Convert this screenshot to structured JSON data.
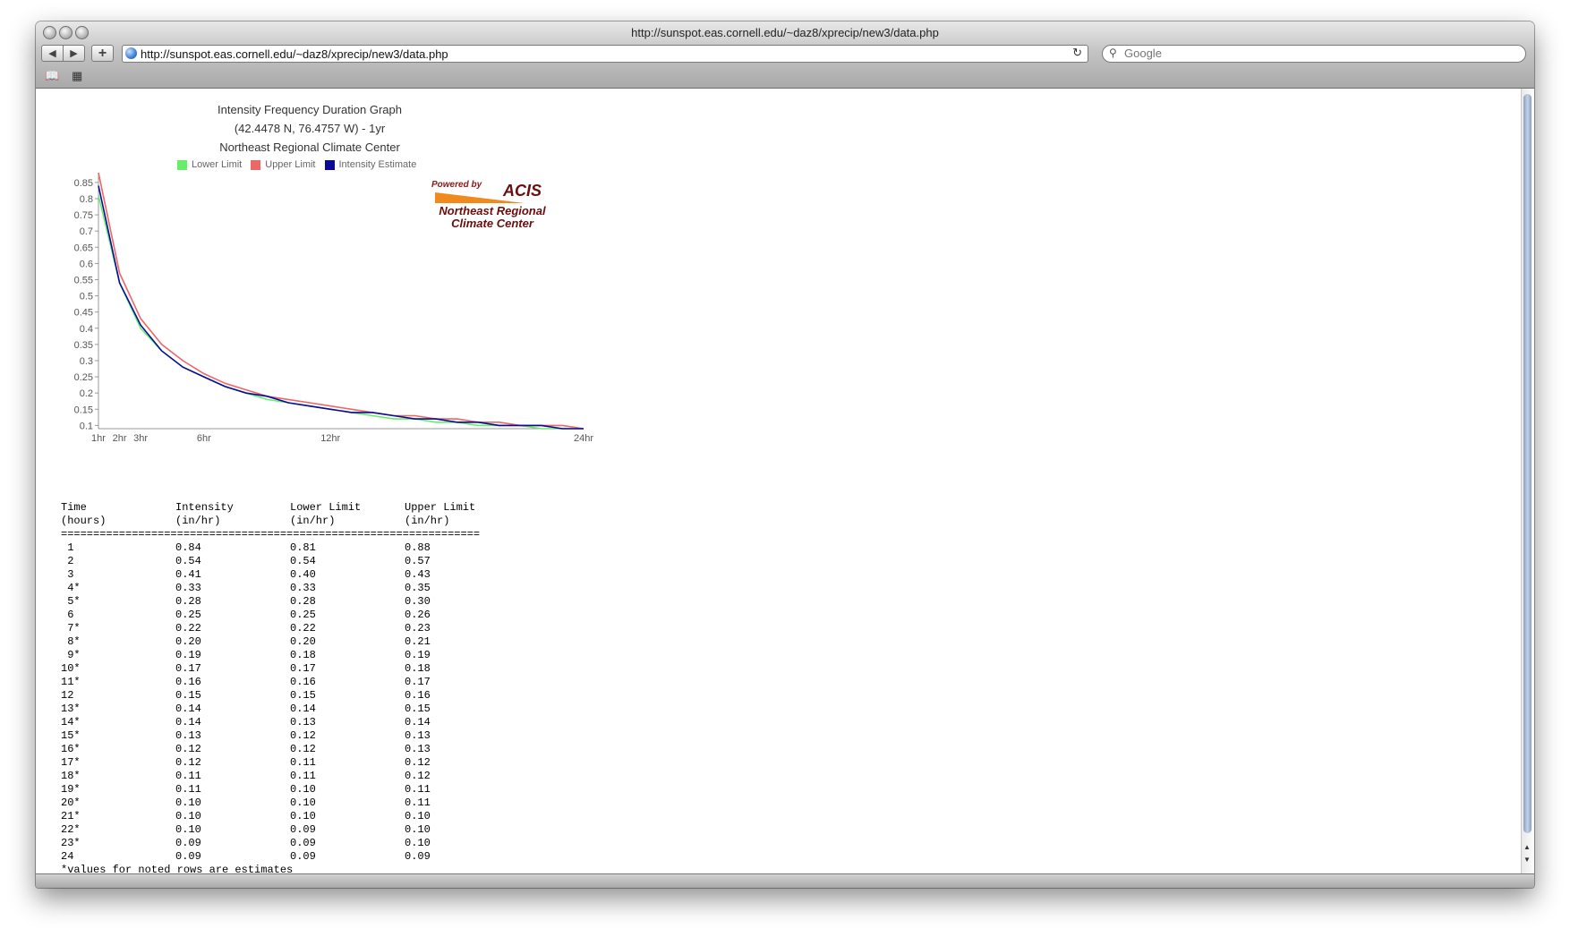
{
  "window": {
    "title": "http://sunspot.eas.cornell.edu/~daz8/xprecip/new3/data.php"
  },
  "toolbar": {
    "back_label": "◀",
    "forward_label": "▶",
    "add_label": "+",
    "url": "http://sunspot.eas.cornell.edu/~daz8/xprecip/new3/data.php",
    "reload_label": "↻",
    "search_placeholder": "Google"
  },
  "chart": {
    "title_lines": [
      "Intensity Frequency Duration Graph",
      "(42.4478 N, 76.4757 W) - 1yr",
      "Northeast Regional Climate Center"
    ],
    "logo": {
      "powered_by": "Powered by",
      "brand": "ACIS",
      "line1": "Northeast Regional",
      "line2": "Climate Center"
    }
  },
  "chart_data": {
    "type": "line",
    "x": [
      1,
      2,
      3,
      4,
      5,
      6,
      7,
      8,
      9,
      10,
      11,
      12,
      13,
      14,
      15,
      16,
      17,
      18,
      19,
      20,
      21,
      22,
      23,
      24
    ],
    "x_tick_labels": [
      {
        "x": 1,
        "label": "1hr"
      },
      {
        "x": 2,
        "label": "2hr"
      },
      {
        "x": 3,
        "label": "3hr"
      },
      {
        "x": 6,
        "label": "6hr"
      },
      {
        "x": 12,
        "label": "12hr"
      },
      {
        "x": 24,
        "label": "24hr"
      }
    ],
    "y_ticks": [
      0.1,
      0.15,
      0.2,
      0.25,
      0.3,
      0.35,
      0.4,
      0.45,
      0.5,
      0.55,
      0.6,
      0.65,
      0.7,
      0.75,
      0.8,
      0.85
    ],
    "y_tick_labels": [
      "0.1",
      "0.15",
      "0.2",
      "0.25",
      "0.3",
      "0.35",
      "0.4",
      "0.45",
      "0.5",
      "0.55",
      "0.6",
      "0.65",
      "0.7",
      "0.75",
      "0.8",
      "0.85"
    ],
    "xlim": [
      1,
      24
    ],
    "ylim": [
      0.09,
      0.88
    ],
    "legend_position": "top",
    "series": [
      {
        "name": "Lower Limit",
        "color": "#66ee66",
        "values": [
          0.81,
          0.54,
          0.4,
          0.33,
          0.28,
          0.25,
          0.22,
          0.2,
          0.18,
          0.17,
          0.16,
          0.15,
          0.14,
          0.13,
          0.12,
          0.12,
          0.11,
          0.11,
          0.1,
          0.1,
          0.1,
          0.09,
          0.09,
          0.09
        ]
      },
      {
        "name": "Upper Limit",
        "color": "#ee6666",
        "values": [
          0.88,
          0.57,
          0.43,
          0.35,
          0.3,
          0.26,
          0.23,
          0.21,
          0.19,
          0.18,
          0.17,
          0.16,
          0.15,
          0.14,
          0.13,
          0.13,
          0.12,
          0.12,
          0.11,
          0.11,
          0.1,
          0.1,
          0.1,
          0.09
        ]
      },
      {
        "name": "Intensity Estimate",
        "color": "#0a0a99",
        "values": [
          0.84,
          0.54,
          0.41,
          0.33,
          0.28,
          0.25,
          0.22,
          0.2,
          0.19,
          0.17,
          0.16,
          0.15,
          0.14,
          0.14,
          0.13,
          0.12,
          0.12,
          0.11,
          0.11,
          0.1,
          0.1,
          0.1,
          0.09,
          0.09
        ]
      }
    ]
  },
  "table": {
    "header_line1": [
      "Time",
      "Intensity",
      "Lower Limit",
      "Upper Limit"
    ],
    "header_line2": [
      "(hours)",
      "(in/hr)",
      "(in/hr)",
      "(in/hr)"
    ],
    "separator": "=================================================================",
    "rows": [
      [
        " 1",
        "0.84",
        "0.81",
        "0.88"
      ],
      [
        " 2",
        "0.54",
        "0.54",
        "0.57"
      ],
      [
        " 3",
        "0.41",
        "0.40",
        "0.43"
      ],
      [
        " 4*",
        "0.33",
        "0.33",
        "0.35"
      ],
      [
        " 5*",
        "0.28",
        "0.28",
        "0.30"
      ],
      [
        " 6",
        "0.25",
        "0.25",
        "0.26"
      ],
      [
        " 7*",
        "0.22",
        "0.22",
        "0.23"
      ],
      [
        " 8*",
        "0.20",
        "0.20",
        "0.21"
      ],
      [
        " 9*",
        "0.19",
        "0.18",
        "0.19"
      ],
      [
        "10*",
        "0.17",
        "0.17",
        "0.18"
      ],
      [
        "11*",
        "0.16",
        "0.16",
        "0.17"
      ],
      [
        "12",
        "0.15",
        "0.15",
        "0.16"
      ],
      [
        "13*",
        "0.14",
        "0.14",
        "0.15"
      ],
      [
        "14*",
        "0.14",
        "0.13",
        "0.14"
      ],
      [
        "15*",
        "0.13",
        "0.12",
        "0.13"
      ],
      [
        "16*",
        "0.12",
        "0.12",
        "0.13"
      ],
      [
        "17*",
        "0.12",
        "0.11",
        "0.12"
      ],
      [
        "18*",
        "0.11",
        "0.11",
        "0.12"
      ],
      [
        "19*",
        "0.11",
        "0.10",
        "0.11"
      ],
      [
        "20*",
        "0.10",
        "0.10",
        "0.11"
      ],
      [
        "21*",
        "0.10",
        "0.10",
        "0.10"
      ],
      [
        "22*",
        "0.10",
        "0.09",
        "0.10"
      ],
      [
        "23*",
        "0.09",
        "0.09",
        "0.10"
      ],
      [
        "24",
        "0.09",
        "0.09",
        "0.09"
      ]
    ],
    "note": "*values for noted rows are estimates"
  },
  "icons": {
    "bookmarks": "📖",
    "grid": "▦",
    "search": "🔍"
  }
}
